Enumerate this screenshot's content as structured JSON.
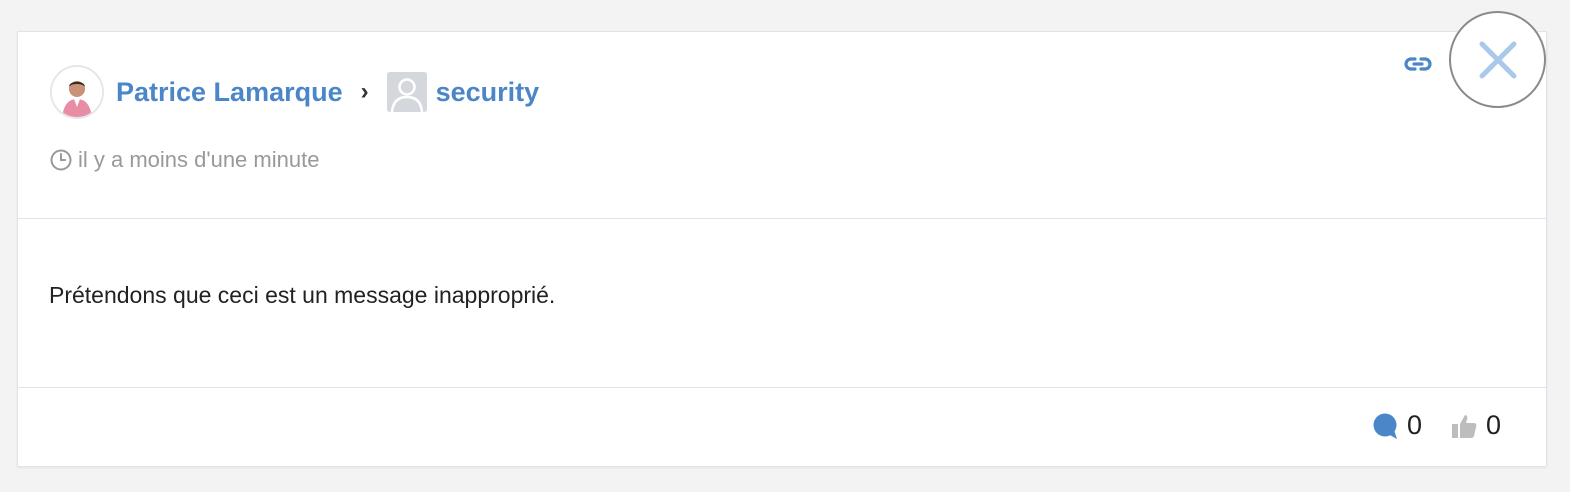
{
  "post": {
    "author_name": "Patrice Lamarque",
    "separator": "›",
    "group_name": "security",
    "timestamp": "il y a moins d'une minute",
    "message": "Prétendons que ceci est un message inapproprié.",
    "comments_count": "0",
    "likes_count": "0"
  },
  "icons": {
    "link": "link-icon",
    "clock": "clock-icon",
    "comment": "comment-bubble-icon",
    "like": "thumbs-up-icon",
    "close": "close-icon"
  },
  "colors": {
    "accent": "#4a86c8",
    "muted_text": "#999999",
    "border": "#dde4ec",
    "close_x": "#a9c9ec"
  }
}
